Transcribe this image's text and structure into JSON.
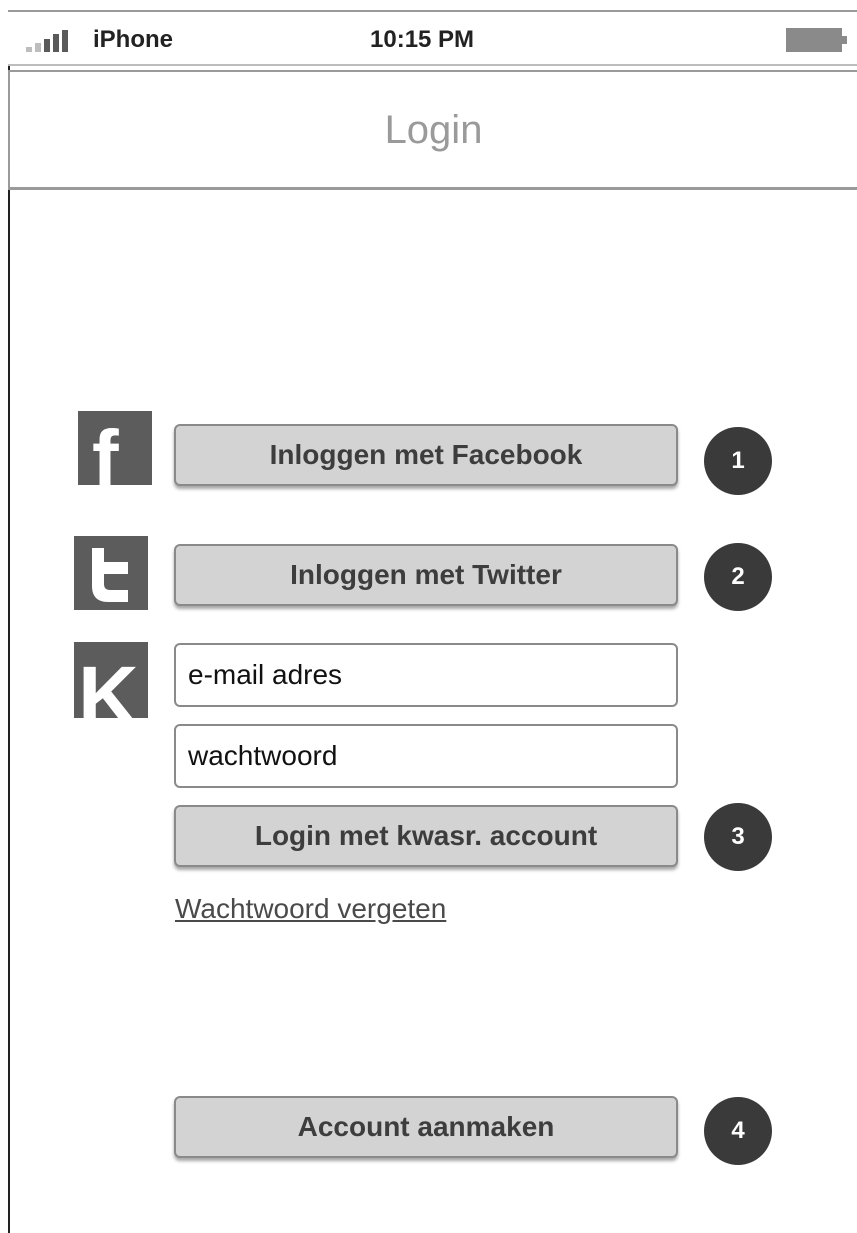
{
  "status_bar": {
    "carrier": "iPhone",
    "time": "10:15 PM",
    "signal_icon": "signal-bars-icon",
    "battery_icon": "battery-icon"
  },
  "nav": {
    "title": "Login"
  },
  "social": {
    "facebook_icon": "facebook-icon",
    "facebook_label": "Inloggen met Facebook",
    "twitter_icon": "twitter-icon",
    "twitter_label": "Inloggen met Twitter"
  },
  "account": {
    "kwasr_icon": "kwasr-icon",
    "email_placeholder": "e-mail adres",
    "password_placeholder": "wachtwoord",
    "login_label": "Login met kwasr. account",
    "forgot_link": "Wachtwoord vergeten",
    "create_label": "Account aanmaken"
  },
  "annotations": [
    "1",
    "2",
    "3",
    "4"
  ]
}
